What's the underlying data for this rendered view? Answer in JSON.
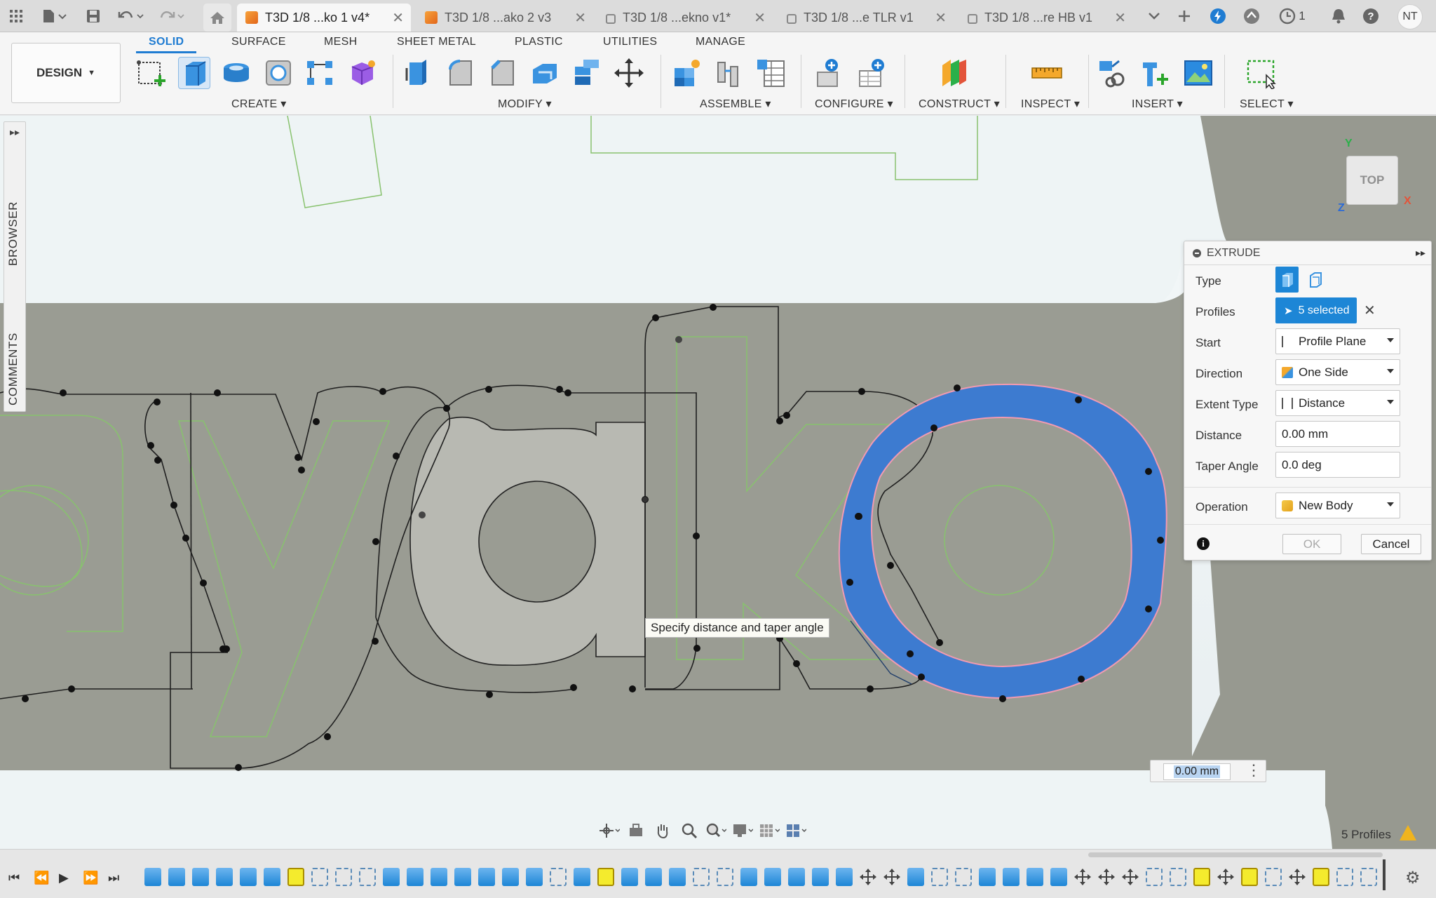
{
  "tabs": [
    {
      "label": "T3D 1/8 ...ko 1 v4*",
      "active": true,
      "icon": "component-cube-icon"
    },
    {
      "label": "T3D 1/8 ...ako 2 v3",
      "active": false,
      "icon": "component-cube-icon"
    },
    {
      "label": "T3D 1/8 ...ekno v1*",
      "active": false,
      "icon": "lock-icon"
    },
    {
      "label": "T3D 1/8 ...e TLR v1",
      "active": false,
      "icon": "lock-icon"
    },
    {
      "label": "T3D 1/8 ...re HB v1",
      "active": false,
      "icon": "lock-icon"
    }
  ],
  "titlebar": {
    "job_count": "1",
    "user_initials": "NT"
  },
  "workspace": {
    "label": "DESIGN"
  },
  "ribbon_tabs": [
    "SOLID",
    "SURFACE",
    "MESH",
    "SHEET METAL",
    "PLASTIC",
    "UTILITIES",
    "MANAGE"
  ],
  "ribbon_groups": [
    "CREATE",
    "MODIFY",
    "ASSEMBLE",
    "CONFIGURE",
    "CONSTRUCT",
    "INSPECT",
    "INSERT",
    "SELECT"
  ],
  "side_panel": {
    "browser": "BROWSER",
    "comments": "COMMENTS"
  },
  "viewcube": {
    "face": "TOP",
    "x": "X",
    "y": "Y",
    "z": "Z"
  },
  "extrude": {
    "title": "EXTRUDE",
    "rows": {
      "type": "Type",
      "profiles": "Profiles",
      "start": "Start",
      "direction": "Direction",
      "extent_type": "Extent Type",
      "distance": "Distance",
      "taper_angle": "Taper Angle",
      "operation": "Operation"
    },
    "profiles_value": "5 selected",
    "start_value": "Profile Plane",
    "direction_value": "One Side",
    "extent_type_value": "Distance",
    "distance_value": "0.00 mm",
    "taper_angle_value": "0.0 deg",
    "operation_value": "New Body",
    "ok_label": "OK",
    "cancel_label": "Cancel"
  },
  "tooltip": "Specify distance and taper angle",
  "dimension_input": "0.00 mm",
  "status": {
    "profiles_count": "5 Profiles"
  },
  "colors": {
    "accent": "#1f7cd2",
    "selection": "#3d7bd0",
    "sketch_line": "#88c26e",
    "warning": "#f0b41e"
  }
}
